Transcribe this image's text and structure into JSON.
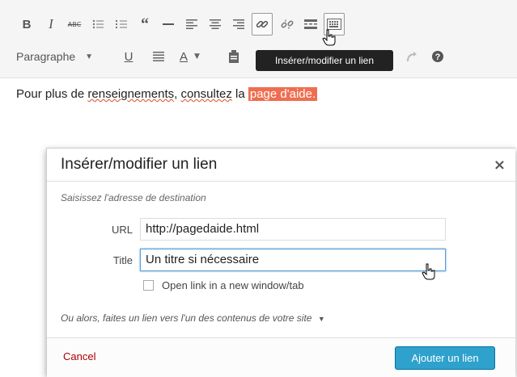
{
  "toolbar": {
    "row1": [
      {
        "icon": "bold-icon"
      },
      {
        "icon": "italic-icon"
      },
      {
        "icon": "strikethrough-icon"
      },
      {
        "icon": "bullet-list-icon"
      },
      {
        "icon": "numbered-list-icon"
      },
      {
        "icon": "blockquote-icon"
      },
      {
        "icon": "horizontal-line-icon"
      },
      {
        "icon": "align-left-icon"
      },
      {
        "icon": "align-center-icon"
      },
      {
        "icon": "align-right-icon"
      },
      {
        "icon": "link-icon"
      },
      {
        "icon": "unlink-icon"
      },
      {
        "icon": "read-more-icon"
      },
      {
        "icon": "toolbar-toggle-icon"
      }
    ],
    "format_select": "Paragraphe",
    "row2": [
      {
        "icon": "underline-icon"
      },
      {
        "icon": "justify-icon"
      },
      {
        "icon": "text-color-icon"
      },
      {
        "icon": "paste-text-icon"
      },
      {
        "icon": "redo-icon"
      },
      {
        "icon": "help-icon"
      }
    ],
    "tooltip": "Insérer/modifier un lien"
  },
  "editor": {
    "text_before": "Pour plus de ",
    "word_1": "renseignements",
    "text_mid": ", ",
    "word_2": "consultez",
    "text_after": " la ",
    "link_text": "page d'aide."
  },
  "modal": {
    "title": "Insérer/modifier un lien",
    "close": "×",
    "dest_label": "Saisissez l'adresse de destination",
    "url_label": "URL",
    "url_value": "http://pagedaide.html",
    "title_label": "Title",
    "title_value": "Un titre si nécessaire",
    "checkbox_label": "Open link in a new window/tab",
    "alt_link": "Ou alors, faites un lien vers l'un des contenus de votre site",
    "cancel": "Cancel",
    "submit": "Ajouter un lien"
  },
  "colors": {
    "accent": "#2ea2cc",
    "link_highlight": "#ee6e4f",
    "cancel": "#aa0000"
  }
}
